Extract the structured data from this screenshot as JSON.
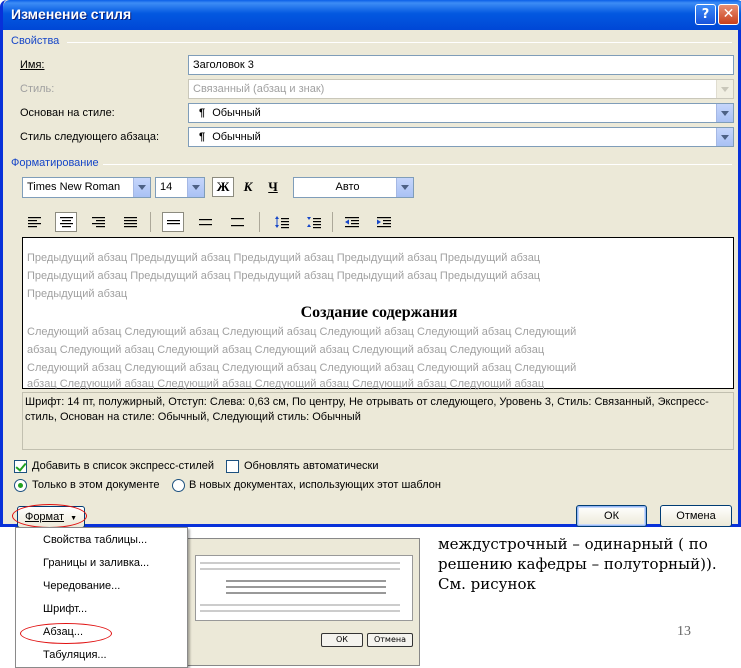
{
  "dialog": {
    "title": "Изменение стиля",
    "help_glyph": "?",
    "close_glyph": "✕"
  },
  "properties": {
    "section_title": "Свойства",
    "name_label": "Имя:",
    "name_value": "Заголовок 3",
    "style_type_label": "Стиль:",
    "style_type_value": "Связанный (абзац и знак)",
    "based_on_label": "Основан на стиле:",
    "based_on_value": "Обычный",
    "next_style_label": "Стиль следующего абзаца:",
    "next_style_value": "Обычный",
    "paragraph_mark": "¶"
  },
  "formatting": {
    "section_title": "Форматирование",
    "font_name": "Times New Roman",
    "font_size": "14",
    "bold_label": "Ж",
    "italic_label": "К",
    "underline_label": "Ч",
    "color_value": "Авто"
  },
  "preview": {
    "previous_lines": [
      "Предыдущий абзац Предыдущий абзац Предыдущий абзац Предыдущий абзац Предыдущий абзац",
      "Предыдущий абзац Предыдущий абзац Предыдущий абзац Предыдущий абзац Предыдущий абзац",
      "Предыдущий абзац"
    ],
    "heading": "Создание содержания",
    "next_lines": [
      "Следующий абзац Следующий абзац Следующий абзац Следующий абзац Следующий абзац Следующий",
      "абзац Следующий абзац Следующий абзац Следующий абзац Следующий абзац Следующий абзац",
      "Следующий абзац Следующий абзац Следующий абзац Следующий абзац Следующий абзац Следующий",
      "абзац Следующий абзац Следующий абзац Следующий абзац Следующий абзац Следующий абзац"
    ]
  },
  "description": {
    "line1": "Шрифт: 14 пт, полужирный, Отступ: Слева:  0,63 см, По центру, Не отрывать от следующего, Уровень 3, Стиль: Связанный, Экспресс-",
    "line2": "стиль, Основан на стиле: Обычный, Следующий стиль: Обычный"
  },
  "options": {
    "add_to_quick_label": "Добавить в список экспресс-стилей",
    "add_to_quick_checked": true,
    "auto_update_label": "Обновлять автоматически",
    "auto_update_checked": false,
    "only_this_doc_label": "Только в этом документе",
    "new_docs_label": "В новых документах, использующих этот шаблон",
    "selected_scope": "only_this_doc"
  },
  "buttons": {
    "format_label": "Формат",
    "format_arrow": "▼",
    "ok_label": "ОК",
    "cancel_label": "Отмена"
  },
  "format_menu": {
    "items": [
      "Свойства таблицы...",
      "Границы и заливка...",
      "Чередование...",
      "Шрифт...",
      "Абзац...",
      "Табуляция..."
    ]
  },
  "background_document": {
    "text_lines": [
      "междустрочный – одинарный ( по",
      "решению кафедры – полуторный)).",
      "См. рисунок"
    ],
    "page_number": "13",
    "thumb_ok": "ОК",
    "thumb_cancel": "Отмена"
  },
  "colors": {
    "title_bar": "#0358e0",
    "section_title": "#1646c8",
    "highlight_ellipse": "#e01010",
    "check_mark": "#21a121"
  }
}
